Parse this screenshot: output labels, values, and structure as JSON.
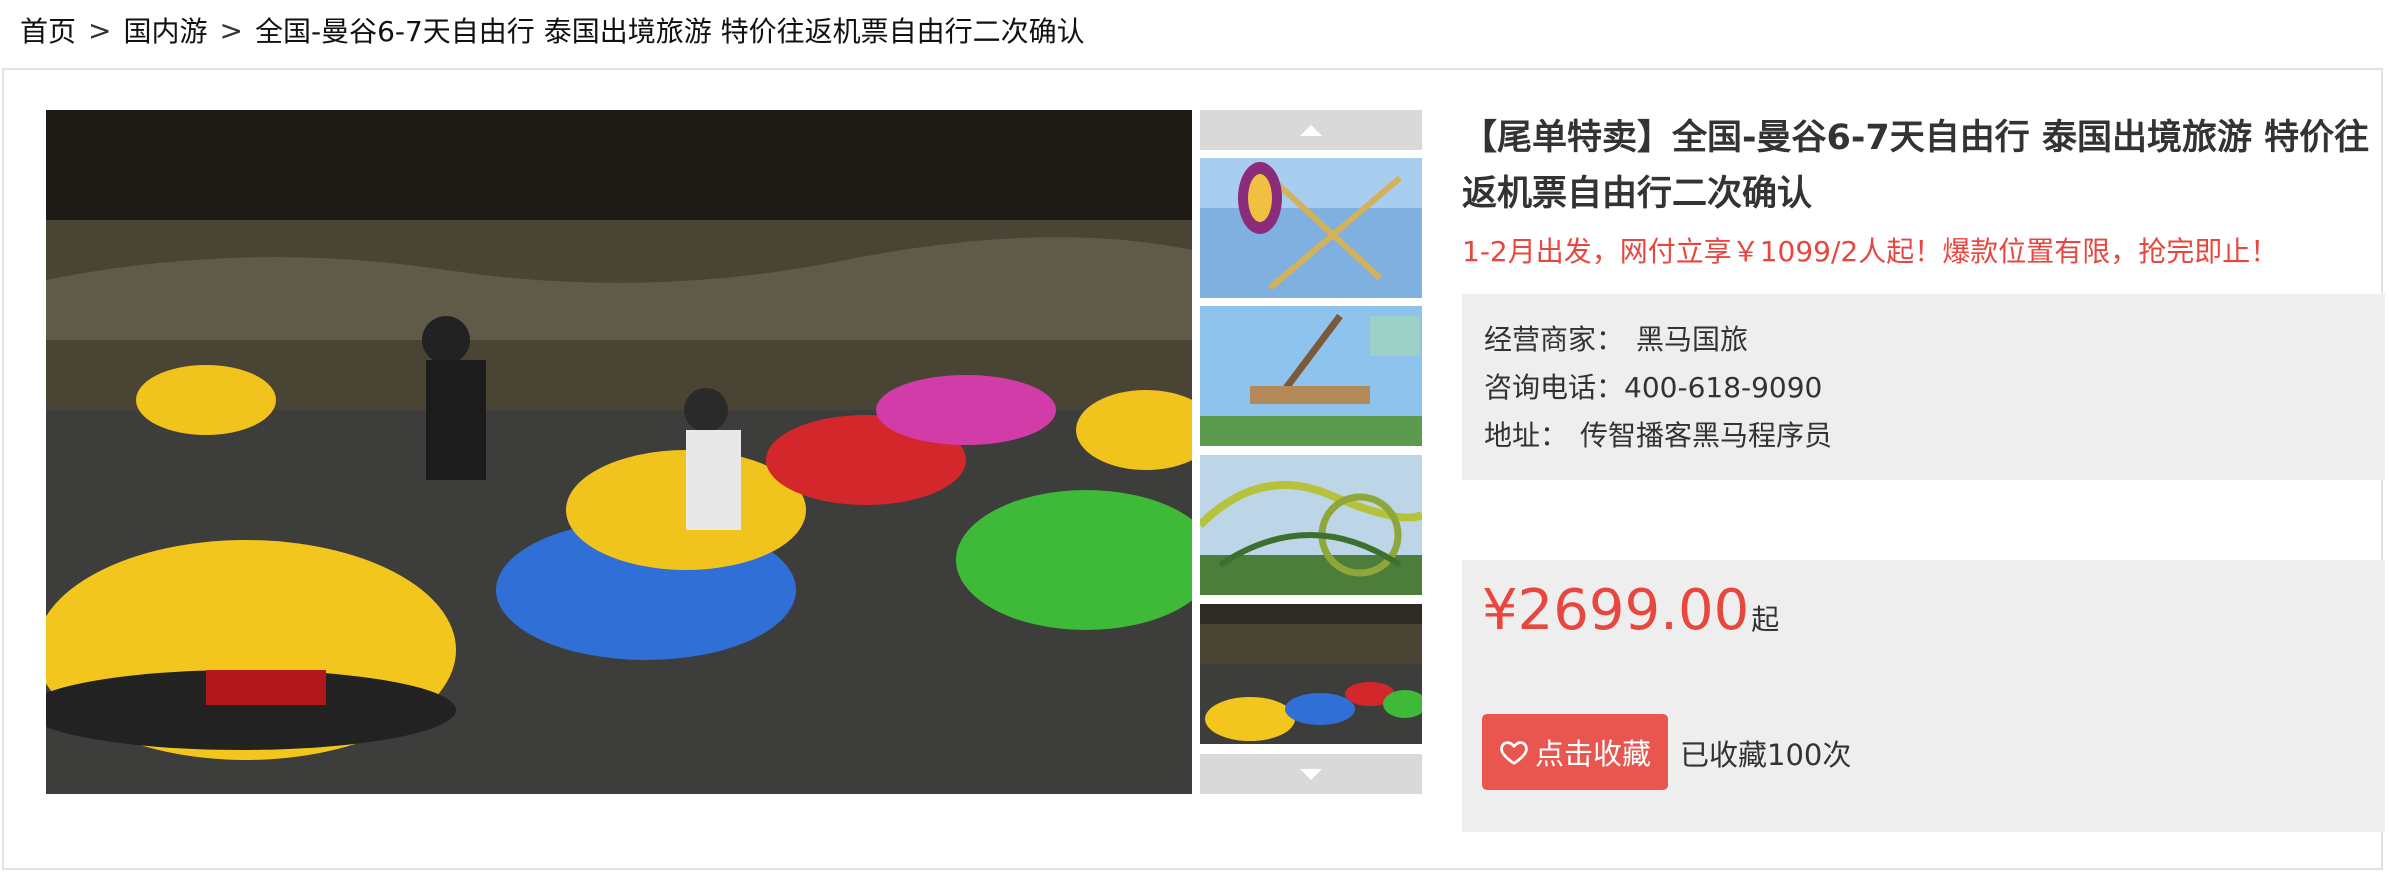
{
  "breadcrumb": {
    "items": [
      "首页",
      "国内游",
      "全国-曼谷6-7天自由行 泰国出境旅游 特价往返机票自由行二次确认"
    ],
    "separator": ">"
  },
  "gallery": {
    "main_image_subject": "bumper cars ride",
    "thumbnails": [
      "pendulum ride",
      "swing ride",
      "roller coaster",
      "bumper cars ride"
    ]
  },
  "product": {
    "title": "【尾单特卖】全国-曼谷6-7天自由行 泰国出境旅游 特价往返机票自由行二次确认",
    "promo": "1-2月出发，网付立享￥1099/2人起！爆款位置有限，抢完即止！"
  },
  "merchant": {
    "name_label": "经营商家：",
    "name_value": "黑马国旅",
    "phone_label": "咨询电话：",
    "phone_value": "400-618-9090",
    "address_label": "地址：",
    "address_value": "传智播客黑马程序员"
  },
  "pricing": {
    "price": "¥2699.00",
    "suffix": "起"
  },
  "favorite": {
    "button_label": "点击收藏",
    "count_text": "已收藏100次",
    "icon": "heart-icon"
  },
  "colors": {
    "accent_red": "#e8473f",
    "button_red": "#e8564f",
    "panel_gray": "#eeeeee",
    "arrow_gray": "#d9d9d9"
  }
}
